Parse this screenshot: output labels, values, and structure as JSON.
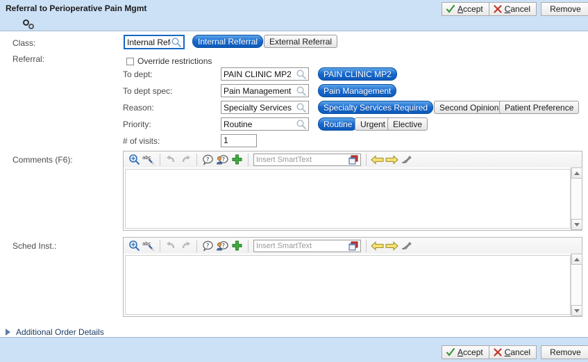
{
  "window": {
    "title": "Referral to Perioperative Pain Mgmt",
    "spinner_icon": "loading-dots-icon"
  },
  "actions": {
    "accept_label": "Accept",
    "accept_accesskey": "A",
    "cancel_label": "Cancel",
    "cancel_accesskey": "C",
    "remove_label": "Remove",
    "accept_icon": "green-check-icon",
    "cancel_icon": "red-x-icon"
  },
  "form": {
    "class_row_label": "Class:",
    "referral_row_label": "Referral:",
    "class_field": {
      "value": "Internal Refe",
      "icon": "magnifier-icon",
      "focused": true
    },
    "class_options": [
      {
        "label": "Internal Referral",
        "selected": true
      },
      {
        "label": "External Referral",
        "selected": false
      }
    ],
    "override": {
      "label": "Override restrictions",
      "checked": false
    },
    "fields": [
      {
        "label": "To dept:",
        "value": "PAIN CLINIC MP2",
        "icon": "magnifier-icon",
        "options": [
          {
            "label": "PAIN CLINIC MP2",
            "selected": true
          }
        ]
      },
      {
        "label": "To dept spec:",
        "value": "Pain Management",
        "icon": "magnifier-icon",
        "options": [
          {
            "label": "Pain Management",
            "selected": true
          }
        ]
      },
      {
        "label": "Reason:",
        "value": "Specialty Services",
        "icon": "magnifier-icon",
        "options": [
          {
            "label": "Specialty Services Required",
            "selected": true
          },
          {
            "label": "Second Opinion",
            "selected": false
          },
          {
            "label": "Patient Preference",
            "selected": false
          }
        ]
      },
      {
        "label": "Priority:",
        "value": "Routine",
        "icon": "magnifier-icon",
        "options": [
          {
            "label": "Routine",
            "selected": true
          },
          {
            "label": "Urgent",
            "selected": false
          },
          {
            "label": "Elective",
            "selected": false
          }
        ]
      }
    ],
    "visits": {
      "label": "# of visits:",
      "value": "1"
    }
  },
  "editors": [
    {
      "label": "Comments (F6):",
      "text": "",
      "toolbar": {
        "zoom_icon": "magnifier-plus-icon",
        "spellcheck_icon": "abc-spellcheck-icon",
        "undo_icon": "undo-arrow-icon",
        "redo_icon": "redo-arrow-icon",
        "help_icon": "question-balloon-icon",
        "user_help_icon": "user-question-balloon-icon",
        "add_icon": "green-plus-icon",
        "smarttext_placeholder": "Insert SmartText",
        "smarttext_value": "",
        "smarttext_book_icon": "smarttext-book-icon",
        "prev_icon": "yellow-left-arrow-icon",
        "next_icon": "yellow-right-arrow-icon",
        "clean_icon": "gray-brush-icon"
      }
    },
    {
      "label": "Sched Inst.:",
      "text": "",
      "toolbar": {
        "zoom_icon": "magnifier-plus-icon",
        "spellcheck_icon": "abc-spellcheck-icon",
        "undo_icon": "undo-arrow-icon",
        "redo_icon": "redo-arrow-icon",
        "help_icon": "question-balloon-icon",
        "user_help_icon": "user-question-balloon-icon",
        "add_icon": "green-plus-icon",
        "smarttext_placeholder": "Insert SmartText",
        "smarttext_value": "",
        "smarttext_book_icon": "smarttext-book-icon",
        "prev_icon": "yellow-left-arrow-icon",
        "next_icon": "yellow-right-arrow-icon",
        "clean_icon": "gray-brush-icon"
      }
    }
  ],
  "additional_order_details": {
    "label": "Additional Order Details",
    "expander_icon": "triangle-right-icon",
    "expanded": false
  },
  "colors": {
    "header_bg": "#cde1f6",
    "selected_chip": "#1769d0",
    "focus_border": "#1568c0",
    "accept_check": "#2f8f2f",
    "cancel_x": "#c0392b",
    "link_text": "#1a3c66"
  }
}
